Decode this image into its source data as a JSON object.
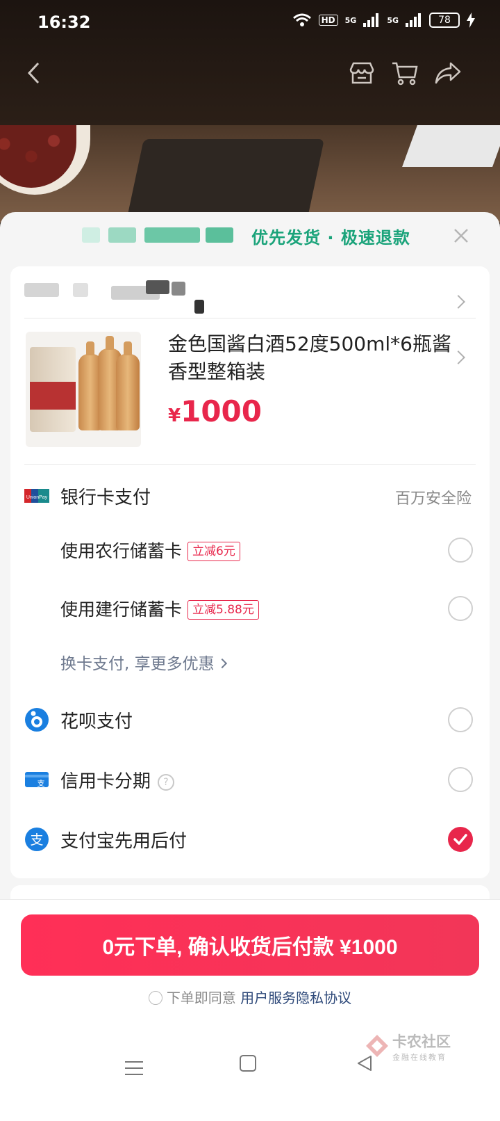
{
  "status": {
    "time": "16:32",
    "battery": "78",
    "network1": "5G",
    "network2": "5G",
    "hd": "HD"
  },
  "nav": {
    "back": "back-icon",
    "store": "store-icon",
    "cart": "cart-icon",
    "share": "share-icon"
  },
  "sheet": {
    "header_text": "优先发货 · 极速退款",
    "close": "close-icon"
  },
  "product": {
    "title": "金色国酱白酒52度500ml*6瓶酱香型整箱装",
    "price_symbol": "¥",
    "price": "1000"
  },
  "payment": {
    "bank_card": {
      "label": "银行卡支付",
      "badge": "百万安全险"
    },
    "abc_card": {
      "label": "使用农行储蓄卡",
      "tag": "立减6元"
    },
    "ccb_card": {
      "label": "使用建行储蓄卡",
      "tag": "立减5.88元"
    },
    "more_link": "换卡支付, 享更多优惠",
    "huabei": {
      "label": "花呗支付"
    },
    "credit_installment": {
      "label": "信用卡分期",
      "help": "?"
    },
    "alipay_later": {
      "label": "支付宝先用后付",
      "selected": true
    }
  },
  "cta": {
    "label": "0元下单, 确认收货后付款 ¥1000"
  },
  "agreement": {
    "prefix": "下单即同意",
    "link": "用户服务隐私协议"
  },
  "watermark": {
    "title": "卡农社区",
    "subtitle": "金融在线教育"
  },
  "colors": {
    "accent": "#e8264b",
    "header_green": "#1aa37a",
    "link_blue": "#2f4a7a"
  }
}
